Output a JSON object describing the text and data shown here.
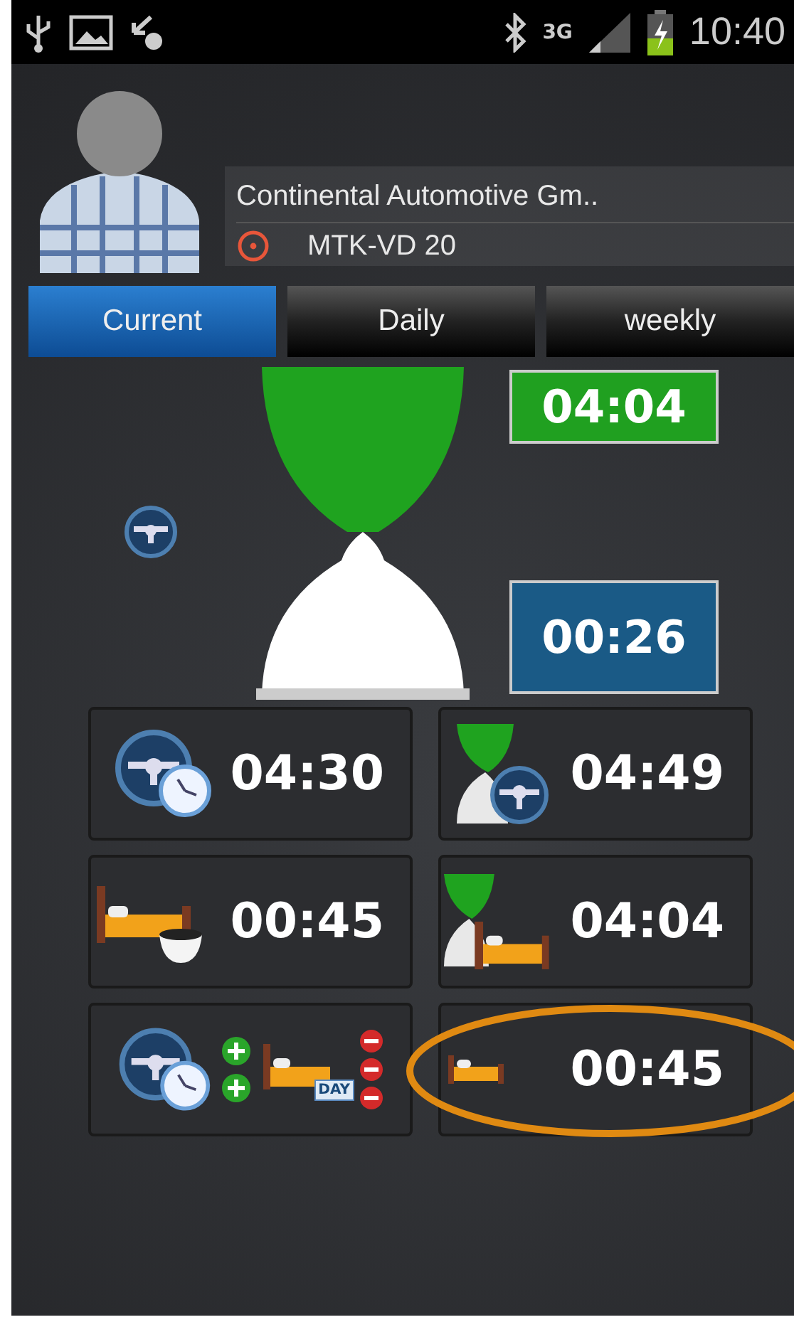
{
  "status_bar": {
    "network": "3G",
    "time": "10:40"
  },
  "header": {
    "company": "Continental Automotive Gm..",
    "vehicle": "MTK-VD 20"
  },
  "tabs": [
    {
      "label": "Current",
      "selected": true
    },
    {
      "label": "Daily",
      "selected": false
    },
    {
      "label": "weekly",
      "selected": false
    }
  ],
  "timer": {
    "remaining": "04:04",
    "elapsed": "00:26"
  },
  "tiles": [
    {
      "kind": "driving",
      "value": "04:30",
      "highlighted": false
    },
    {
      "kind": "remaining-driving",
      "value": "04:49",
      "highlighted": false
    },
    {
      "kind": "break",
      "value": "00:45",
      "highlighted": false
    },
    {
      "kind": "remaining-rest",
      "value": "04:04",
      "highlighted": false
    },
    {
      "kind": "extensions",
      "badge": "DAY",
      "highlighted": false
    },
    {
      "kind": "rest",
      "value": "00:45",
      "highlighted": true
    }
  ]
}
